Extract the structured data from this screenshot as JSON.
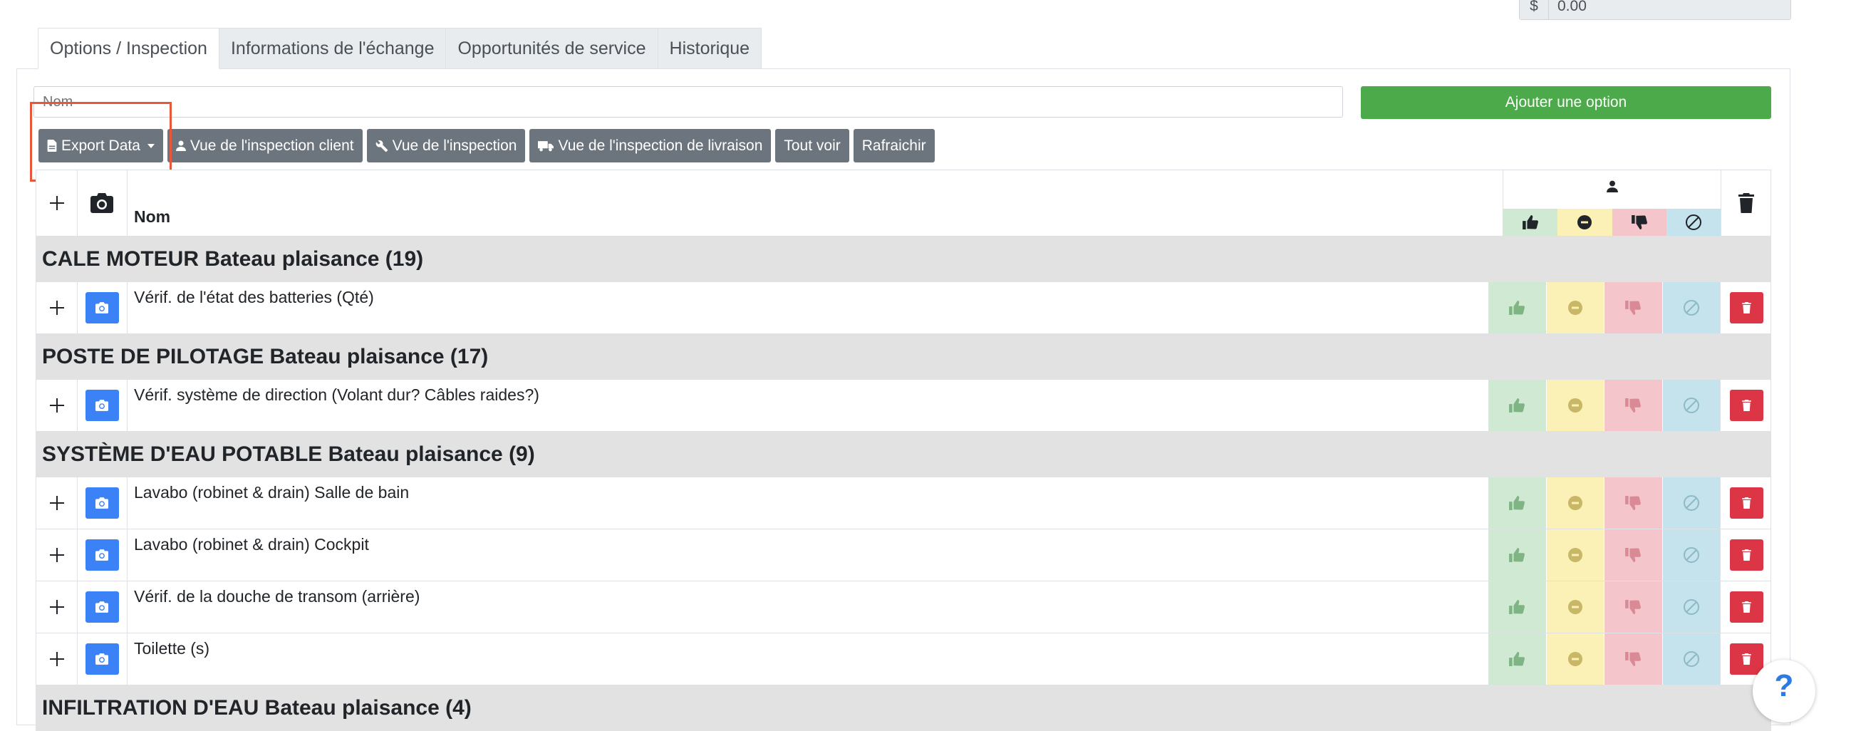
{
  "top_right": {
    "currency": "$",
    "value": "0.00"
  },
  "tabs": [
    {
      "label": "Options / Inspection"
    },
    {
      "label": "Informations de l'échange"
    },
    {
      "label": "Opportunités de service"
    },
    {
      "label": "Historique"
    }
  ],
  "name_input": {
    "placeholder": "Nom",
    "value": ""
  },
  "add_option_label": "Ajouter une option",
  "toolbar": {
    "export_label": "Export Data",
    "client_view_label": "Vue de l'inspection client",
    "inspection_view_label": "Vue de l'inspection",
    "delivery_view_label": "Vue de l'inspection de livraison",
    "show_all_label": "Tout voir",
    "refresh_label": "Rafraichir"
  },
  "table": {
    "name_header": "Nom",
    "sections": [
      {
        "title": "CALE MOTEUR Bateau plaisance (19)",
        "rows": [
          "Vérif. de l'état des batteries (Qté)"
        ]
      },
      {
        "title": "POSTE DE PILOTAGE Bateau plaisance (17)",
        "rows": [
          "Vérif. système de direction (Volant dur? Câbles raides?)"
        ]
      },
      {
        "title": "SYSTÈME D'EAU POTABLE Bateau plaisance (9)",
        "rows": [
          "Lavabo (robinet & drain) Salle de bain",
          "Lavabo (robinet & drain) Cockpit",
          "Vérif. de la douche de transom (arrière)",
          "Toilette (s)"
        ]
      },
      {
        "title": "INFILTRATION D'EAU Bateau plaisance (4)",
        "rows": []
      }
    ]
  },
  "help_label": "?",
  "colors": {
    "accent_green": "#4caa4a",
    "secondary": "#6c757d",
    "camera_blue": "#3b82f6",
    "danger_red": "#dc3545",
    "highlight": "#e8573a"
  }
}
